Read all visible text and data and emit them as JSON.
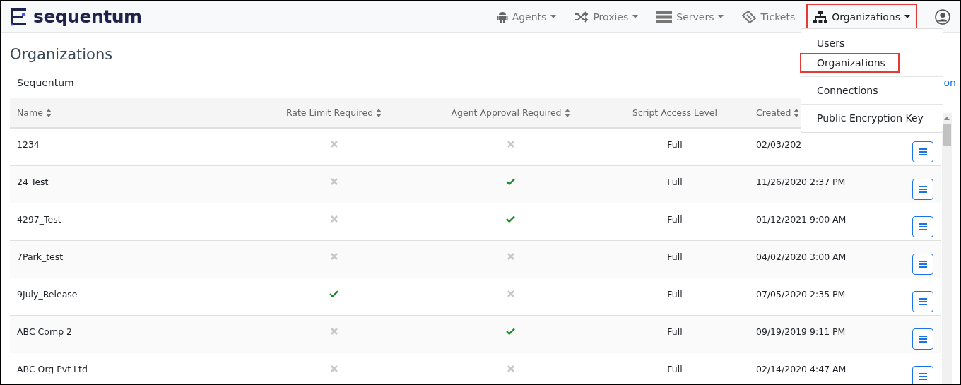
{
  "brand": {
    "name": "sequentum"
  },
  "nav": [
    {
      "label": "Agents",
      "caret": true,
      "highlighted": false
    },
    {
      "label": "Proxies",
      "caret": true,
      "highlighted": false
    },
    {
      "label": "Servers",
      "caret": true,
      "highlighted": false
    },
    {
      "label": "Tickets",
      "caret": false,
      "highlighted": false
    },
    {
      "label": "Organizations",
      "caret": true,
      "highlighted": true
    }
  ],
  "dropdown": [
    {
      "label": "Users",
      "highlighted": false,
      "divider_before": false
    },
    {
      "label": "Organizations",
      "highlighted": true,
      "divider_before": false
    },
    {
      "label": "Connections",
      "highlighted": false,
      "divider_before": true
    },
    {
      "label": "Public Encryption Key",
      "highlighted": false,
      "divider_before": true
    }
  ],
  "page_title": "Organizations",
  "org_name": "Sequentum",
  "side_link": "on",
  "table": {
    "columns": [
      {
        "label": "Name",
        "sortable": true
      },
      {
        "label": "Rate Limit Required",
        "sortable": true
      },
      {
        "label": "Agent Approval Required",
        "sortable": true
      },
      {
        "label": "Script Access Level",
        "sortable": false
      },
      {
        "label": "Created",
        "sortable": true
      }
    ],
    "rows": [
      {
        "name": "1234",
        "rate_limit": false,
        "agent_approval": false,
        "access": "Full",
        "created": "02/03/202"
      },
      {
        "name": "24 Test",
        "rate_limit": false,
        "agent_approval": true,
        "access": "Full",
        "created": "11/26/2020 2:37 PM"
      },
      {
        "name": "4297_Test",
        "rate_limit": false,
        "agent_approval": true,
        "access": "Full",
        "created": "01/12/2021 9:00 AM"
      },
      {
        "name": "7Park_test",
        "rate_limit": false,
        "agent_approval": false,
        "access": "Full",
        "created": "04/02/2020 3:00 AM"
      },
      {
        "name": "9July_Release",
        "rate_limit": true,
        "agent_approval": false,
        "access": "Full",
        "created": "07/05/2020 2:35 PM"
      },
      {
        "name": "ABC Comp 2",
        "rate_limit": false,
        "agent_approval": true,
        "access": "Full",
        "created": "09/19/2019 9:11 PM"
      },
      {
        "name": "ABC Org Pvt Ltd",
        "rate_limit": false,
        "agent_approval": false,
        "access": "Full",
        "created": "02/14/2020 4:47 AM"
      }
    ]
  }
}
